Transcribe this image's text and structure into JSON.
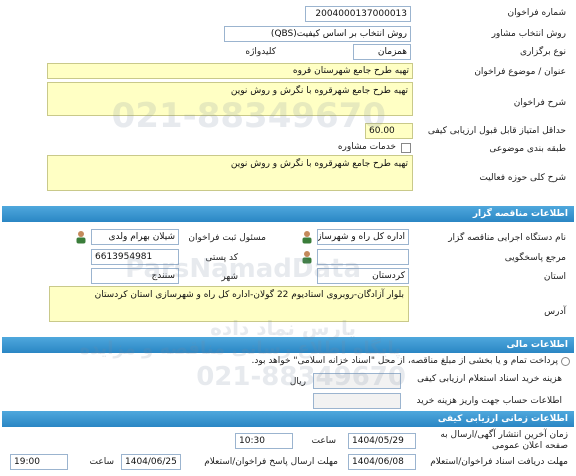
{
  "tender": {
    "number_label": "شماره فراخوان",
    "number_value": "2004000137000013",
    "method_label": "روش انتخاب مشاور",
    "method_value": "روش انتخاب بر اساس کیفیت(QBS)",
    "type_label": "نوع برگزاری",
    "type_value": "همزمان",
    "keyword_label": "کلیدواژه",
    "subject_label": "عنوان / موضوع فراخوان",
    "subject_value": "تهیه طرح جامع شهرستان قروه",
    "description_label": "شرح فراخوان",
    "description_value": "تهیه طرح جامع شهرقروه با نگرش و روش نوین",
    "min_score_label": "حداقل امتیاز قابل قبول ارزیابی کیفی",
    "min_score_value": "60.00",
    "category_label": "طبقه بندی موضوعی",
    "category_value": "خدمات مشاوره",
    "scope_label": "شرح کلی حوزه فعالیت",
    "scope_value": "تهیه طرح جامع شهرقروه با نگرش و روش نوین"
  },
  "organizer": {
    "section_title": "اطلاعات مناقصه گزار",
    "org_label": "نام دستگاه اجرایی مناقصه گزار",
    "org_value": "اداره کل راه و شهرسازی استان",
    "responsible_label": "مسئول ثبت فراخوان",
    "responsible_value": "شیلان بهرام ولدی",
    "reference_label": "مرجع پاسخگویی",
    "postal_label": "کد پستی",
    "postal_value": "6613954981",
    "province_label": "استان",
    "province_value": "کردستان",
    "city_label": "شهر",
    "city_value": "سنندج",
    "address_label": "آدرس",
    "address_value": "بلوار آزادگان-روبروی استادیوم 22 گولان-اداره کل راه و شهرسازی استان کردستان"
  },
  "financial": {
    "section_title": "اطلاعات مالی",
    "payment_text": "پرداخت تمام و یا بخشی از مبلغ مناقصه، از محل \"اسناد خزانه اسلامی\" خواهد بود.",
    "doc_fee_label": "هزینه خرید اسناد استعلام ارزیابی کیفی",
    "currency": "ریال",
    "account_label": "اطلاعات حساب جهت واریز هزینه خرید"
  },
  "schedule": {
    "section_title": "اطلاعات زمانی ارزیابی کیفی",
    "publish_label": "زمان آخرین انتشار آگهی/ارسال به صفحه اعلان عمومی",
    "publish_date": "1404/05/29",
    "time_label": "ساعت",
    "publish_time": "10:30",
    "deadline_label": "مهلت ارسال پاسخ فراخوان/استعلام",
    "deadline_date": "1404/06/25",
    "deadline_time": "19:00",
    "docs_deadline_label": "مهلت دریافت اسناد فراخوان/استعلام",
    "docs_deadline_date": "1404/06/08",
    "docs_deadline_time": "19:00"
  },
  "watermark": {
    "phone": "021-88349670",
    "site_en": "ParsNamadData",
    "site_fa": "پارس نماد داده",
    "caption": "پایگاه اطلاع رسانی مناقصه و مزایده"
  }
}
